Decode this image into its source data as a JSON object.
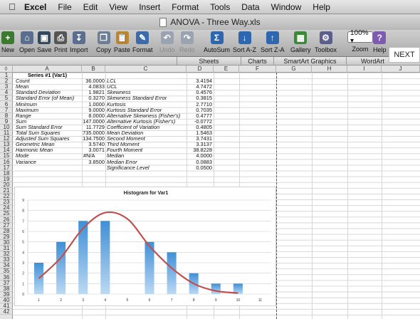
{
  "menubar": {
    "app": "Excel",
    "items": [
      "File",
      "Edit",
      "View",
      "Insert",
      "Format",
      "Tools",
      "Data",
      "Window",
      "Help"
    ]
  },
  "window": {
    "title": "ANOVA - Three Way.xls"
  },
  "toolbar": {
    "items": [
      {
        "label": "New",
        "icon": "new-document-icon",
        "color": "#3b7a2f"
      },
      {
        "label": "Open",
        "icon": "open-folder-icon",
        "color": "#5a6f8f"
      },
      {
        "label": "Save",
        "icon": "save-disk-icon",
        "color": "#34495e"
      },
      {
        "label": "Print",
        "icon": "printer-icon",
        "color": "#555555"
      },
      {
        "label": "Import",
        "icon": "import-icon",
        "color": "#5a6f8f"
      },
      {
        "label": "Copy",
        "icon": "copy-icon",
        "color": "#6d7f95"
      },
      {
        "label": "Paste",
        "icon": "paste-icon",
        "color": "#b8872e"
      },
      {
        "label": "Format",
        "icon": "format-brush-icon",
        "color": "#3d6aa8"
      },
      {
        "label": "Undo",
        "icon": "undo-icon",
        "color": "#9aa4b1"
      },
      {
        "label": "Redo",
        "icon": "redo-icon",
        "color": "#9aa4b1"
      },
      {
        "label": "AutoSum",
        "icon": "sigma-icon",
        "color": "#2e66b0"
      },
      {
        "label": "Sort A-Z",
        "icon": "sort-ascending-icon",
        "color": "#2e66b0"
      },
      {
        "label": "Sort Z-A",
        "icon": "sort-descending-icon",
        "color": "#2e66b0"
      },
      {
        "label": "Gallery",
        "icon": "gallery-icon",
        "color": "#3b8a3b"
      },
      {
        "label": "Toolbox",
        "icon": "toolbox-icon",
        "color": "#5b5e8a"
      },
      {
        "label": "Zoom",
        "icon": "zoom-icon",
        "color": "#ffffff"
      },
      {
        "label": "Help",
        "icon": "help-icon",
        "color": "#7c5bb0"
      }
    ],
    "zoom_value": "100%"
  },
  "next_button": "NEXT",
  "ribbon_tabs": [
    "Sheets",
    "Charts",
    "SmartArt Graphics",
    "WordArt"
  ],
  "columns": [
    "A",
    "B",
    "C",
    "D",
    "E",
    "F",
    "G",
    "H",
    "I",
    "J"
  ],
  "rows": [
    "1",
    "2",
    "3",
    "4",
    "5",
    "6",
    "7",
    "8",
    "9",
    "10",
    "11",
    "12",
    "13",
    "14",
    "15",
    "16",
    "17",
    "18",
    "19",
    "20",
    "21",
    "22",
    "23",
    "24",
    "25",
    "26",
    "27",
    "28",
    "29",
    "30",
    "31",
    "32",
    "33",
    "34",
    "35",
    "36",
    "37",
    "38",
    "39",
    "40",
    "41",
    "42"
  ],
  "header_cell": "Series #1 (Var1)",
  "table_left": [
    {
      "label": "Count",
      "value": "36.0000"
    },
    {
      "label": "Mean",
      "value": "4.0833"
    },
    {
      "label": "Standard Deviation",
      "value": "1.9821"
    },
    {
      "label": "Standard Error (of Mean)",
      "value": "0.3270"
    },
    {
      "label": "Minimum",
      "value": "1.0000"
    },
    {
      "label": "Maximum",
      "value": "9.0000"
    },
    {
      "label": "Range",
      "value": "8.0000"
    },
    {
      "label": "Sum",
      "value": "147.0000"
    },
    {
      "label": "Sum Standard Error",
      "value": "11.7729"
    },
    {
      "label": "Total Sum Squares",
      "value": "735.0000"
    },
    {
      "label": "Adjusted Sum Squares",
      "value": "134.7500"
    },
    {
      "label": "Geometric Mean",
      "value": "3.5740"
    },
    {
      "label": "Harmonic Mean",
      "value": "3.0071"
    },
    {
      "label": "Mode",
      "value": "#N/A"
    },
    {
      "label": "Variance",
      "value": "3.8500"
    }
  ],
  "table_right": [
    {
      "label": "LCL",
      "value": "3.4194"
    },
    {
      "label": "UCL",
      "value": "4.7472"
    },
    {
      "label": "Skewness",
      "value": "0.4576"
    },
    {
      "label": "Skewness Standard Error",
      "value": "0.3815"
    },
    {
      "label": "Kurtosis",
      "value": "2.7710"
    },
    {
      "label": "Kurtosis Standard Error",
      "value": "0.7035"
    },
    {
      "label": "Alternative Skewness (Fisher's)",
      "value": "0.4777"
    },
    {
      "label": "Alternative Kurtosis (Fisher's)",
      "value": "-0.0772"
    },
    {
      "label": "Coefficient of Variation",
      "value": "0.4805"
    },
    {
      "label": "Mean Deviation",
      "value": "1.5463"
    },
    {
      "label": "Second Moment",
      "value": "3.7431"
    },
    {
      "label": "Third Moment",
      "value": "3.3137"
    },
    {
      "label": "Fourth Moment",
      "value": "38.8228"
    },
    {
      "label": "Median",
      "value": "4.0000"
    },
    {
      "label": "Median Error",
      "value": "0.0883"
    },
    {
      "label": "Significance Level",
      "value": "0.0500"
    }
  ],
  "chart_data": {
    "type": "bar",
    "title": "Histogram for Var1",
    "categories": [
      "1",
      "2",
      "3",
      "4",
      "5",
      "6",
      "7",
      "8",
      "9",
      "10",
      "11"
    ],
    "values": [
      3,
      5,
      7,
      7,
      0,
      5,
      4,
      2,
      1,
      1,
      0
    ],
    "overlay_curve": [
      1.5,
      3.5,
      6.3,
      7.8,
      7.2,
      4.6,
      2.5,
      1.0,
      0.3,
      0.1
    ],
    "ylim": [
      0,
      9
    ],
    "yticks": [
      "0",
      "1",
      "2",
      "3",
      "4",
      "5",
      "6",
      "7",
      "8",
      "9"
    ],
    "grid": true,
    "bar_color": "#3f8fd6",
    "curve_color": "#c0504d"
  }
}
